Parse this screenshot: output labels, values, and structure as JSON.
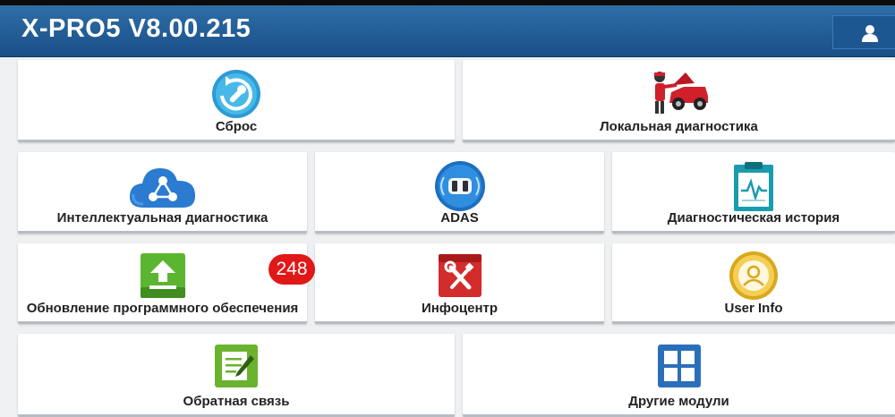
{
  "header": {
    "title": "X-PRO5 V8.00.215"
  },
  "tiles": {
    "reset": {
      "label": "Сброс"
    },
    "local_diagnostics": {
      "label": "Локальная диагностика"
    },
    "intelligent_diagnostics": {
      "label": "Интеллектуальная диагностика"
    },
    "adas": {
      "label": "ADAS"
    },
    "diagnostic_history": {
      "label": "Диагностическая история"
    },
    "software_update": {
      "label": "Обновление программного обеспечения",
      "badge": "248"
    },
    "infocenter": {
      "label": "Инфоцентр"
    },
    "user_info": {
      "label": "User Info"
    },
    "feedback": {
      "label": "Обратная связь"
    },
    "other_modules": {
      "label": "Другие модули"
    }
  },
  "colors": {
    "header": "#1f5a94",
    "badge": "#e01818",
    "update_icon": "#5cb531",
    "infocenter_icon": "#d32c2c",
    "other_modules_icon": "#2b6fba"
  }
}
